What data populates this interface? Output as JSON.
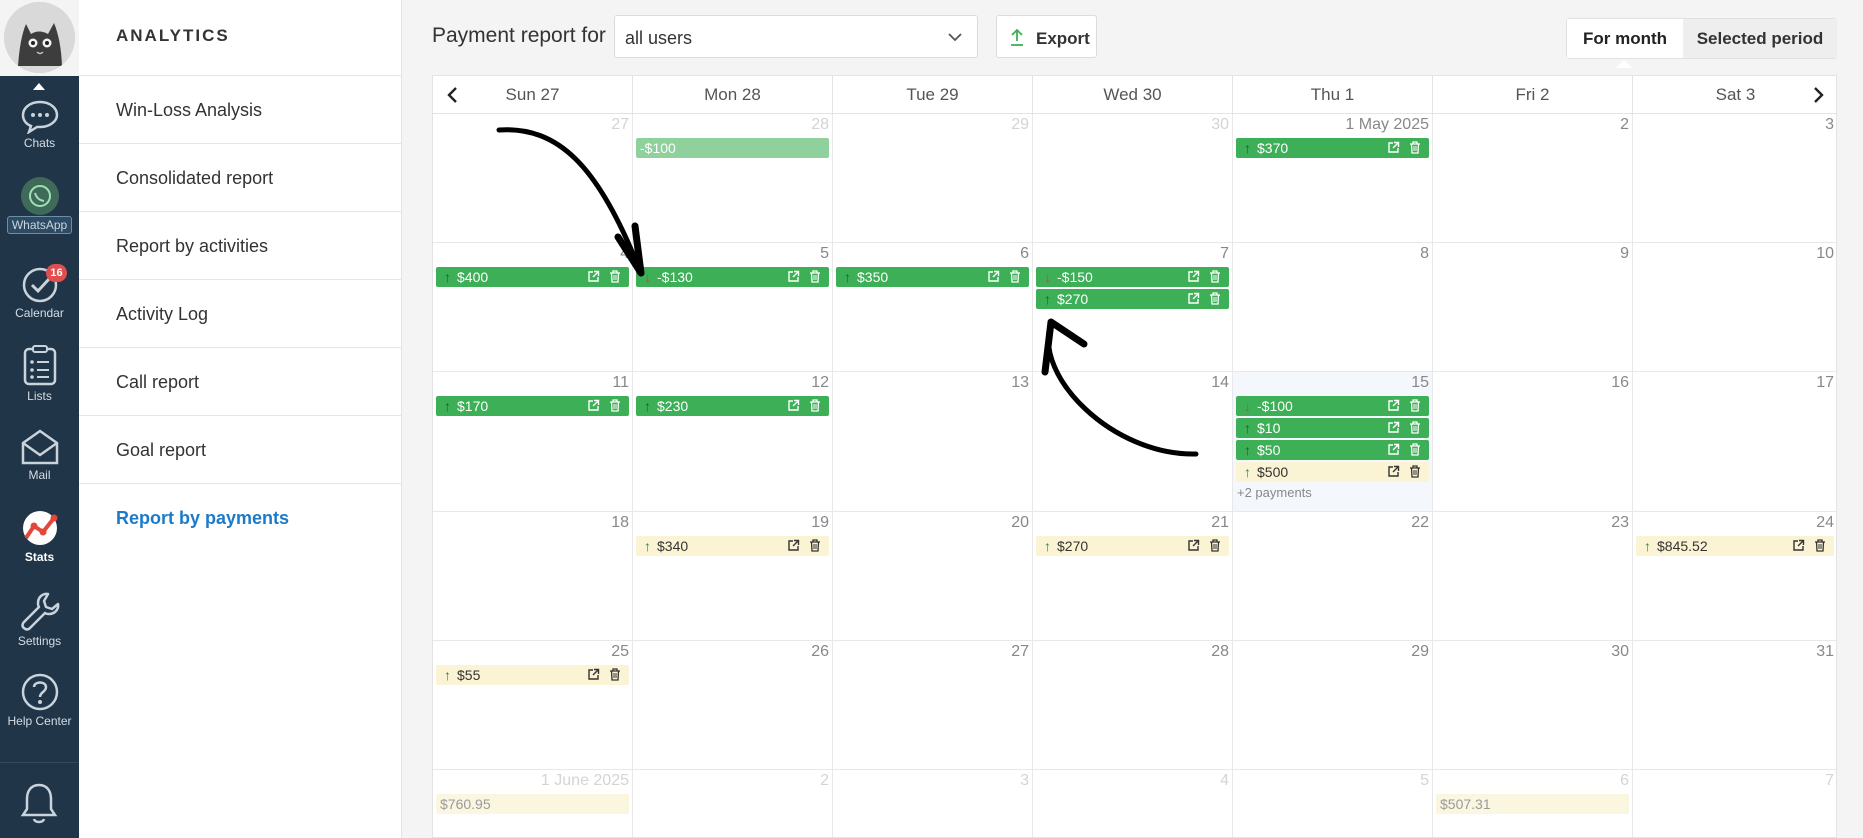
{
  "rail": {
    "items": [
      {
        "label": "Chats",
        "icon": "chat-bubble-icon"
      },
      {
        "label": "WhatsApp",
        "icon": "whatsapp-icon"
      },
      {
        "label": "Calendar",
        "icon": "calendar-check-icon",
        "badge": "16"
      },
      {
        "label": "Lists",
        "icon": "list-icon"
      },
      {
        "label": "Mail",
        "icon": "mail-icon"
      },
      {
        "label": "Stats",
        "icon": "stats-chart-icon"
      },
      {
        "label": "Settings",
        "icon": "wrench-icon"
      },
      {
        "label": "Help Center",
        "icon": "help-circle-icon"
      }
    ],
    "bell_icon": "bell-icon"
  },
  "menu": {
    "title": "ANALYTICS",
    "items": [
      {
        "label": "Win-Loss Analysis"
      },
      {
        "label": "Consolidated report"
      },
      {
        "label": "Report by activities"
      },
      {
        "label": "Activity Log"
      },
      {
        "label": "Call report"
      },
      {
        "label": "Goal report"
      },
      {
        "label": "Report by payments",
        "active": true
      }
    ]
  },
  "header": {
    "label": "Payment report for",
    "user_select": {
      "value": "all users"
    },
    "export_label": "Export",
    "tabs": [
      {
        "label": "For month",
        "selected": true
      },
      {
        "label": "Selected period",
        "selected": false
      }
    ]
  },
  "calendar": {
    "weekdays": [
      "Sun 27",
      "Mon 28",
      "Tue 29",
      "Wed 30",
      "Thu 1",
      "Fri 2",
      "Sat 3"
    ],
    "colors": {
      "income": "#3daf57",
      "pending": "#faf3d4",
      "accent": "#1c7bc8"
    },
    "weeks": [
      [
        {
          "label": "27",
          "faded": true,
          "payments": []
        },
        {
          "label": "28",
          "faded": true,
          "payments": [
            {
              "amount": "-$100",
              "style": "lightgreen",
              "dir": "none",
              "actions": false
            }
          ]
        },
        {
          "label": "29",
          "faded": true,
          "payments": []
        },
        {
          "label": "30",
          "faded": true,
          "payments": []
        },
        {
          "label": "1 May 2025",
          "payments": [
            {
              "amount": "$370",
              "style": "green",
              "dir": "up",
              "actions": true
            }
          ]
        },
        {
          "label": "2",
          "payments": []
        },
        {
          "label": "3",
          "payments": []
        }
      ],
      [
        {
          "label": "4",
          "payments": [
            {
              "amount": "$400",
              "style": "green",
              "dir": "up",
              "actions": true
            }
          ]
        },
        {
          "label": "5",
          "payments": [
            {
              "amount": "-$130",
              "style": "green",
              "dir": "down",
              "actions": true
            }
          ]
        },
        {
          "label": "6",
          "payments": [
            {
              "amount": "$350",
              "style": "green",
              "dir": "up",
              "actions": true
            }
          ]
        },
        {
          "label": "7",
          "payments": [
            {
              "amount": "-$150",
              "style": "green",
              "dir": "down",
              "actions": true
            },
            {
              "amount": "$270",
              "style": "green",
              "dir": "up",
              "actions": true
            }
          ]
        },
        {
          "label": "8",
          "payments": []
        },
        {
          "label": "9",
          "payments": []
        },
        {
          "label": "10",
          "payments": []
        }
      ],
      [
        {
          "label": "11",
          "payments": [
            {
              "amount": "$170",
              "style": "green",
              "dir": "up",
              "actions": true
            }
          ]
        },
        {
          "label": "12",
          "payments": [
            {
              "amount": "$230",
              "style": "green",
              "dir": "up",
              "actions": true
            }
          ]
        },
        {
          "label": "13",
          "payments": []
        },
        {
          "label": "14",
          "payments": []
        },
        {
          "label": "15",
          "today": true,
          "more": "+2 payments",
          "payments": [
            {
              "amount": "-$100",
              "style": "green",
              "dir": "down",
              "actions": true
            },
            {
              "amount": "$10",
              "style": "green",
              "dir": "up",
              "actions": true
            },
            {
              "amount": "$50",
              "style": "green",
              "dir": "up",
              "actions": true
            },
            {
              "amount": "$500",
              "style": "yellow",
              "dir": "up",
              "actions": true
            }
          ]
        },
        {
          "label": "16",
          "payments": []
        },
        {
          "label": "17",
          "payments": []
        }
      ],
      [
        {
          "label": "18",
          "payments": []
        },
        {
          "label": "19",
          "payments": [
            {
              "amount": "$340",
              "style": "yellow",
              "dir": "up",
              "actions": true
            }
          ]
        },
        {
          "label": "20",
          "payments": []
        },
        {
          "label": "21",
          "payments": [
            {
              "amount": "$270",
              "style": "yellow",
              "dir": "up",
              "actions": true
            }
          ]
        },
        {
          "label": "22",
          "payments": []
        },
        {
          "label": "23",
          "payments": []
        },
        {
          "label": "24",
          "payments": [
            {
              "amount": "$845.52",
              "style": "yellow",
              "dir": "up",
              "actions": true
            }
          ]
        }
      ],
      [
        {
          "label": "25",
          "payments": [
            {
              "amount": "$55",
              "style": "yellow",
              "dir": "up",
              "actions": true
            }
          ]
        },
        {
          "label": "26",
          "payments": []
        },
        {
          "label": "27",
          "payments": []
        },
        {
          "label": "28",
          "payments": []
        },
        {
          "label": "29",
          "payments": []
        },
        {
          "label": "30",
          "payments": []
        },
        {
          "label": "31",
          "payments": []
        }
      ],
      [
        {
          "label": "1 June 2025",
          "faded": true,
          "payments": [
            {
              "amount": "$760.95",
              "style": "fadedyellow",
              "dir": "none",
              "actions": false
            }
          ]
        },
        {
          "label": "2",
          "faded": true,
          "payments": []
        },
        {
          "label": "3",
          "faded": true,
          "payments": []
        },
        {
          "label": "4",
          "faded": true,
          "payments": []
        },
        {
          "label": "5",
          "faded": true,
          "payments": []
        },
        {
          "label": "6",
          "faded": true,
          "payments": [
            {
              "amount": "$507.31",
              "style": "fadedyellow",
              "dir": "none",
              "actions": false
            }
          ]
        },
        {
          "label": "7",
          "faded": true,
          "payments": []
        }
      ]
    ]
  }
}
